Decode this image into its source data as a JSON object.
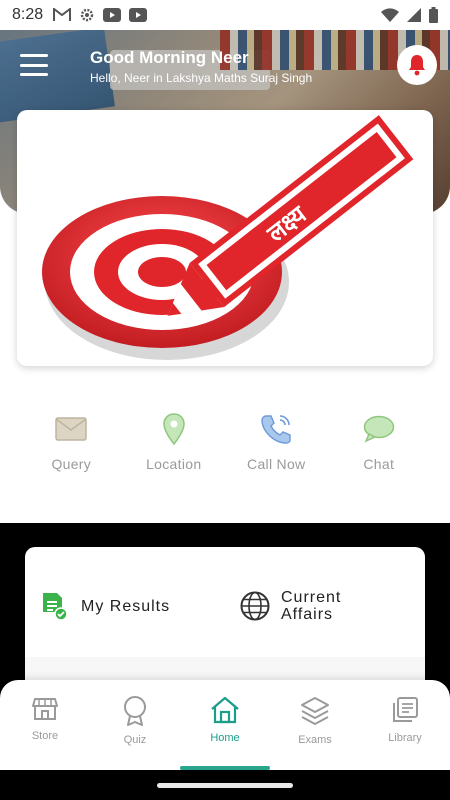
{
  "status": {
    "time": "8:28",
    "left_icons": [
      "gmail-icon",
      "settings-icon",
      "youtube-icon",
      "youtube-icon"
    ],
    "right_icons": [
      "wifi-icon",
      "signal-icon",
      "battery-icon"
    ]
  },
  "header": {
    "title": "Good Morning Neer",
    "subtitle": "Hello, Neer in Lakshya Maths Suraj Singh",
    "banner_logo_text": "लक्ष्य"
  },
  "quick_actions": [
    {
      "label": "Query",
      "icon": "mail-icon",
      "color": "#c9c2b2"
    },
    {
      "label": "Location",
      "icon": "location-pin-icon",
      "color": "#a8d39a"
    },
    {
      "label": "Call Now",
      "icon": "phone-icon",
      "color": "#7aa7df"
    },
    {
      "label": "Chat",
      "icon": "chat-bubble-icon",
      "color": "#a8d39a"
    }
  ],
  "cards": {
    "my_results": "My Results",
    "current_affairs_line1": "Current",
    "current_affairs_line2": "Affairs"
  },
  "nav": [
    {
      "label": "Store",
      "icon": "store-icon"
    },
    {
      "label": "Quiz",
      "icon": "award-icon"
    },
    {
      "label": "Home",
      "icon": "home-icon",
      "active": true
    },
    {
      "label": "Exams",
      "icon": "layers-icon"
    },
    {
      "label": "Library",
      "icon": "library-icon"
    }
  ],
  "colors": {
    "accent": "#1a9e8a",
    "banner_red": "#e0262b",
    "results_green": "#3cb34a"
  }
}
